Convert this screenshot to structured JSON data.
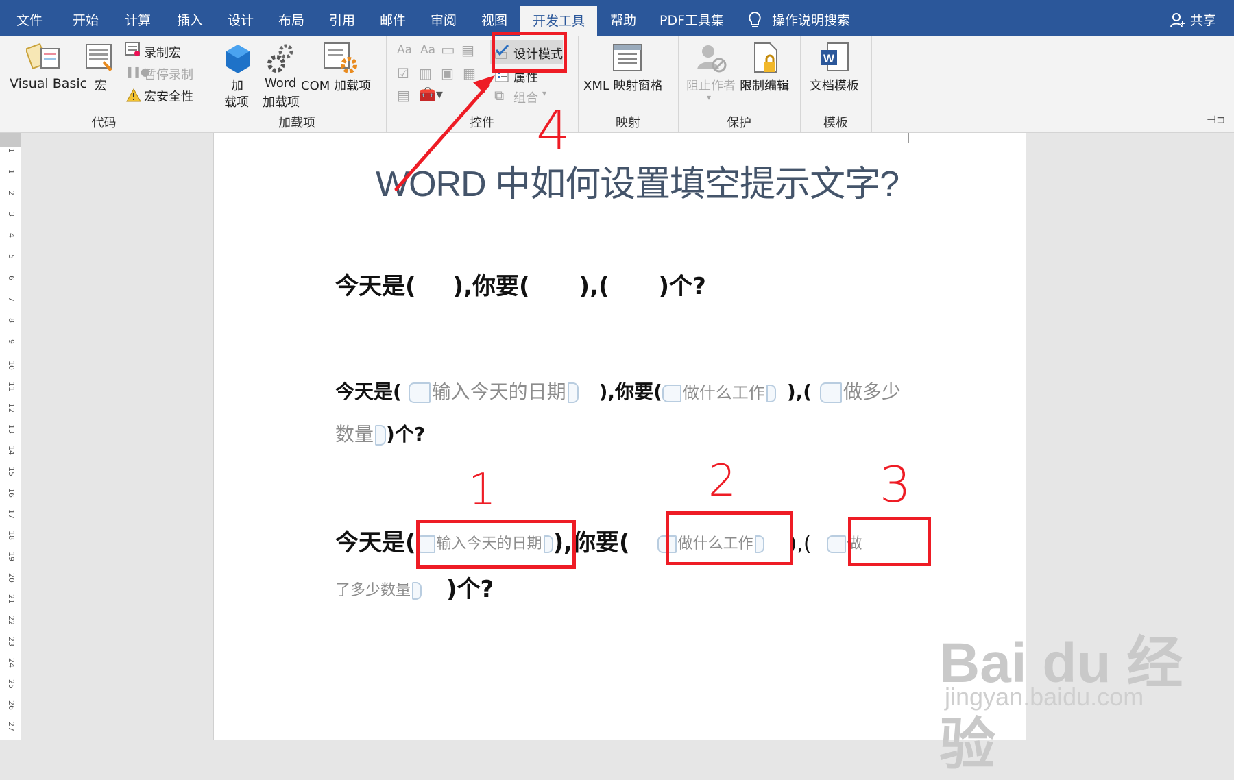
{
  "tabs": [
    "文件",
    "开始",
    "计算",
    "插入",
    "设计",
    "布局",
    "引用",
    "邮件",
    "审阅",
    "视图",
    "开发工具",
    "帮助",
    "PDF工具集"
  ],
  "active_tab": "开发工具",
  "tell_me": "操作说明搜索",
  "share": "共享",
  "ribbon": {
    "code": {
      "label": "代码",
      "visual_basic": "Visual Basic",
      "macros": "宏",
      "record_macro": "录制宏",
      "pause_recording": "暂停录制",
      "macro_security": "宏安全性"
    },
    "addins": {
      "label": "加载项",
      "addins_line1": "加",
      "addins_line2": "载项",
      "word_line1": "Word",
      "word_line2": "加载项",
      "com": "COM 加载项"
    },
    "controls": {
      "label": "控件",
      "design_mode": "设计模式",
      "properties": "属性",
      "group": "组合"
    },
    "mapping": {
      "label": "映射",
      "xml_pane": "XML 映射窗格"
    },
    "protect": {
      "label": "保护",
      "block_authors": "阻止作者",
      "restrict_editing": "限制编辑"
    },
    "templates": {
      "label": "模板",
      "document_template": "文档模板"
    }
  },
  "ruler_numbers": [
    "1",
    "1",
    "2",
    "3",
    "4",
    "5",
    "6",
    "7",
    "8",
    "9",
    "10",
    "11",
    "12",
    "13",
    "14",
    "15",
    "16",
    "17",
    "18",
    "19",
    "20",
    "21",
    "22",
    "23",
    "24",
    "25",
    "26",
    "27"
  ],
  "document": {
    "title": "WORD 中如何设置填空提示文字?",
    "line1": {
      "a": "今天是(",
      "b": "),你要(",
      "c": "),(",
      "d": ")个?"
    },
    "line2": {
      "a": "今天是(",
      "ph1": "输入今天的日期",
      "b": "),你要(",
      "ph2": "做什么工作",
      "c": "),(",
      "ph3": "做多少"
    },
    "line3": {
      "ph3b": "数量",
      "d": ")个?"
    },
    "line4": {
      "a": "今天是(",
      "ph1": "输入今天的日期",
      "b": "),你要(",
      "ph2": "做什么工作",
      "c": "),(",
      "ph3": "做"
    },
    "line5": {
      "ph3b": "了多少数量",
      "d": ")个?"
    }
  },
  "annotations": {
    "n1": "1",
    "n2": "2",
    "n3": "3",
    "n4": "4"
  },
  "watermark": {
    "logo": "Bai du 经验",
    "url": "jingyan.baidu.com"
  },
  "colors": {
    "tabbar": "#2b579a",
    "annotation": "#ee1c25",
    "title": "#44546a"
  }
}
